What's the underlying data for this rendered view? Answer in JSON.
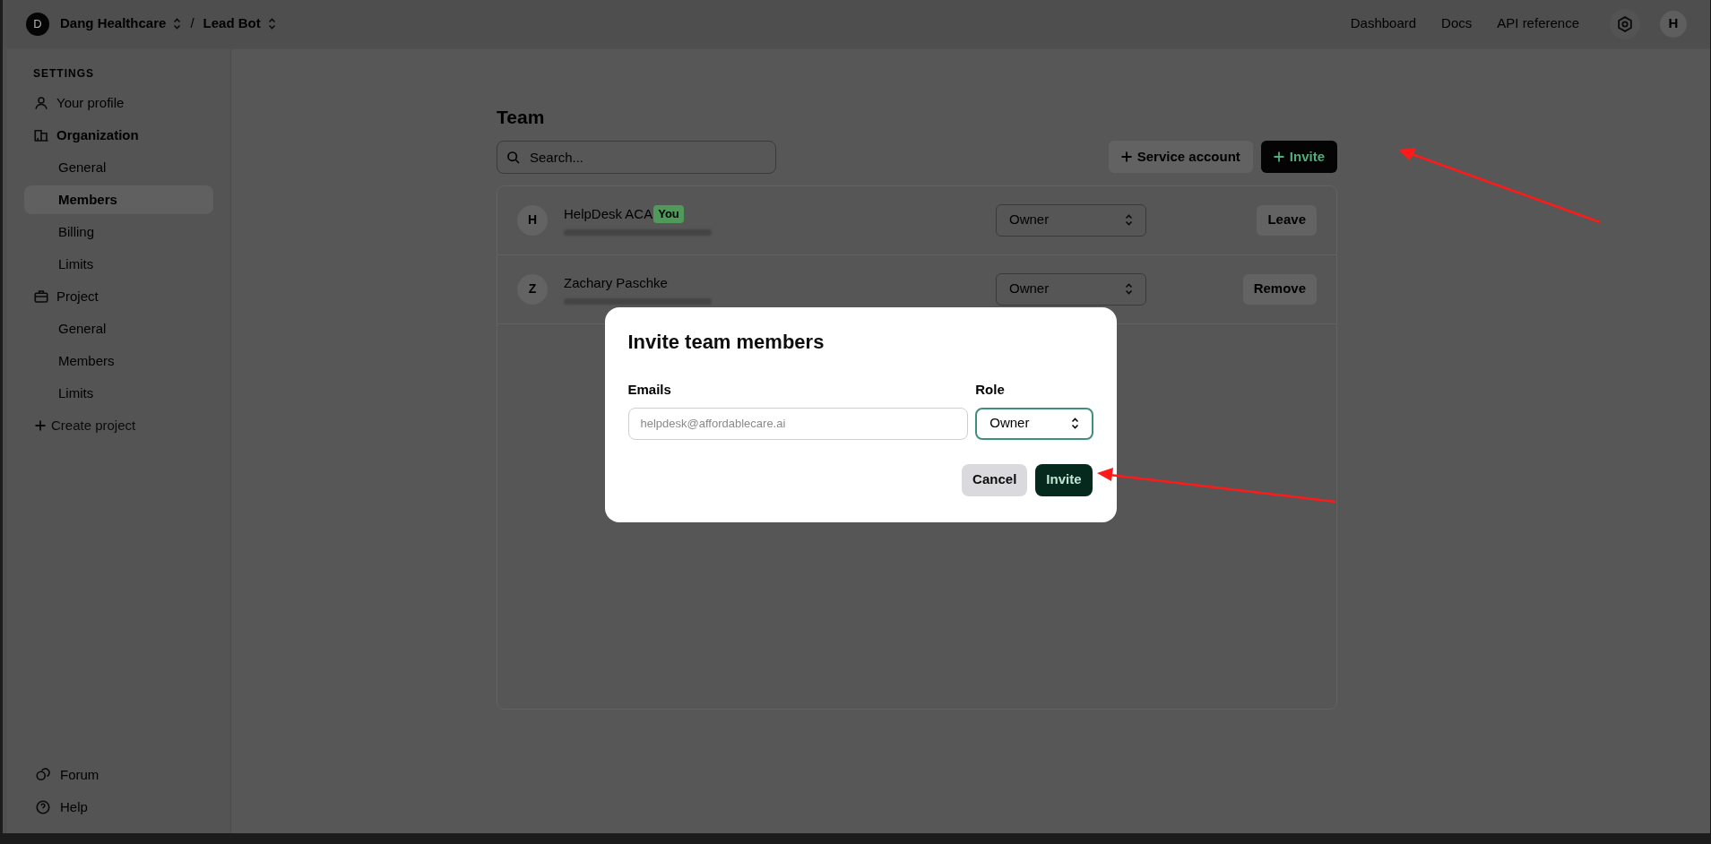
{
  "top_bar": {
    "org_initial": "D",
    "org": "Dang Healthcare",
    "separator": "/",
    "project": "Lead Bot",
    "links": [
      "Dashboard",
      "Docs",
      "API reference"
    ],
    "user_initial": "H"
  },
  "sidebar": {
    "heading": "SETTINGS",
    "sections": [
      {
        "label": "Your profile",
        "active": false
      },
      {
        "label": "Organization",
        "active": true,
        "children": [
          {
            "label": "General",
            "selected": false
          },
          {
            "label": "Members",
            "selected": true
          },
          {
            "label": "Billing",
            "selected": false
          },
          {
            "label": "Limits",
            "selected": false
          }
        ]
      },
      {
        "label": "Project",
        "active": false,
        "children": [
          {
            "label": "General",
            "selected": false
          },
          {
            "label": "Members",
            "selected": false
          },
          {
            "label": "Limits",
            "selected": false
          }
        ]
      }
    ],
    "create": "Create project",
    "footer": [
      "Forum",
      "Help"
    ]
  },
  "team": {
    "title": "Team",
    "search": {
      "placeholder": "Search..."
    },
    "buttons": [
      {
        "label": "Service account",
        "kind": "secondary"
      },
      {
        "label": "Invite",
        "kind": "primary"
      }
    ],
    "members": [
      {
        "initial": "H",
        "name": "HelpDesk ACA",
        "badge": "You",
        "role": "Owner",
        "action": "Leave"
      },
      {
        "initial": "Z",
        "name": "Zachary Paschke",
        "role": "Owner",
        "action": "Remove"
      }
    ]
  },
  "modal": {
    "title": "Invite team members",
    "emails_label": "Emails",
    "emails_value": "helpdesk@affordablecare.ai",
    "role_label": "Role",
    "role_value": "Owner",
    "buttons": [
      {
        "label": "Cancel",
        "kind": "secondary"
      },
      {
        "label": "Invite",
        "kind": "primary"
      }
    ]
  }
}
